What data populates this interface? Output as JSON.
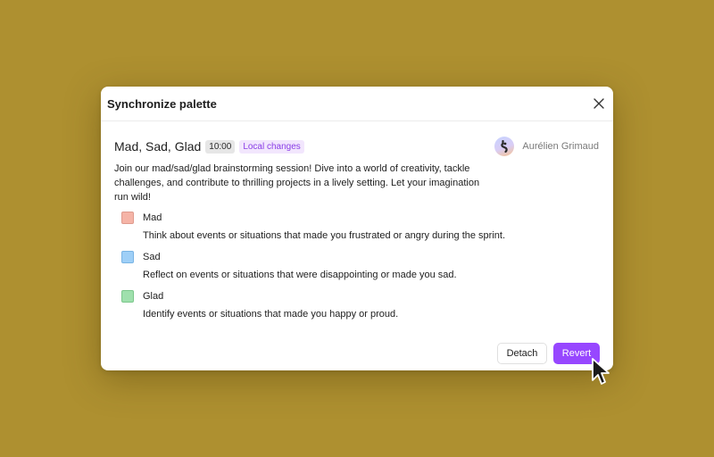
{
  "dialog": {
    "title": "Synchronize palette",
    "close_icon": "close-icon"
  },
  "board": {
    "title": "Mad, Sad, Glad",
    "time": "10:00",
    "status": "Local changes",
    "description": "Join our mad/sad/glad brainstorming session! Dive into a world of creativity, tackle challenges, and contribute to thrilling projects in a lively setting. Let your imagination run wild!"
  },
  "author": {
    "name": "Aurélien Grimaud",
    "avatar_icon": "avatar-icon"
  },
  "categories": [
    {
      "name": "Mad",
      "description": "Think about events or situations that made you frustrated or angry during the sprint.",
      "color": "#f5b4a7"
    },
    {
      "name": "Sad",
      "description": "Reflect on events or situations that were disappointing or made you sad.",
      "color": "#9ecff7"
    },
    {
      "name": "Glad",
      "description": "Identify events or situations that made you happy or proud.",
      "color": "#9fe0ad"
    }
  ],
  "actions": {
    "detach_label": "Detach",
    "revert_label": "Revert"
  },
  "colors": {
    "background": "#ae9030",
    "accent": "#9747ff",
    "badge_text": "#8a3ee6",
    "badge_bg": "#f2e6fd"
  }
}
